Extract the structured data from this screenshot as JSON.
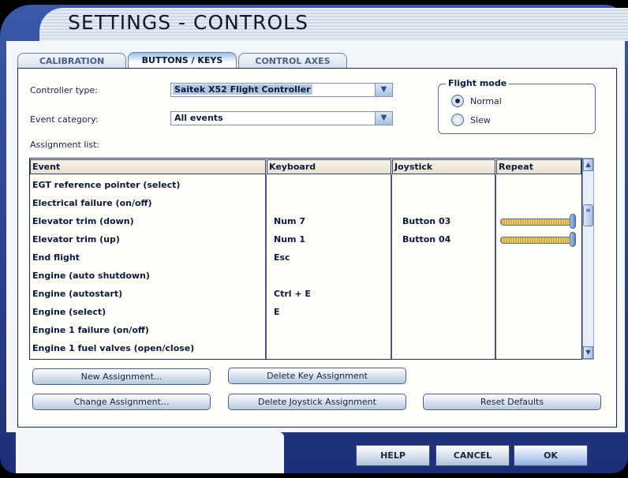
{
  "window": {
    "title": "SETTINGS - CONTROLS"
  },
  "tabs": [
    {
      "label": "CALIBRATION",
      "active": false
    },
    {
      "label": "BUTTONS / KEYS",
      "active": true
    },
    {
      "label": "CONTROL AXES",
      "active": false
    }
  ],
  "form": {
    "controller_type_label": "Controller type:",
    "controller_type_value": "Saitek X52 Flight Controller",
    "event_category_label": "Event category:",
    "event_category_value": "All events",
    "assignment_list_label": "Assignment list:"
  },
  "flight_mode": {
    "title": "Flight mode",
    "options": [
      {
        "label": "Normal",
        "selected": true
      },
      {
        "label": "Slew",
        "selected": false
      }
    ]
  },
  "table": {
    "headers": [
      "Event",
      "Keyboard",
      "Joystick",
      "Repeat"
    ],
    "rows": [
      {
        "event": "EGT reference pointer (select)",
        "keyboard": "",
        "joystick": "",
        "repeat": null
      },
      {
        "event": "Electrical failure (on/off)",
        "keyboard": "",
        "joystick": "",
        "repeat": null
      },
      {
        "event": "Elevator trim (down)",
        "keyboard": "Num 7",
        "joystick": "Button 03",
        "repeat": 1.0
      },
      {
        "event": "Elevator trim (up)",
        "keyboard": "Num 1",
        "joystick": "Button 04",
        "repeat": 1.0
      },
      {
        "event": "End flight",
        "keyboard": "Esc",
        "joystick": "",
        "repeat": null
      },
      {
        "event": "Engine (auto shutdown)",
        "keyboard": "",
        "joystick": "",
        "repeat": null
      },
      {
        "event": "Engine (autostart)",
        "keyboard": "Ctrl + E",
        "joystick": "",
        "repeat": null
      },
      {
        "event": "Engine (select)",
        "keyboard": "E",
        "joystick": "",
        "repeat": null
      },
      {
        "event": "Engine 1 failure (on/off)",
        "keyboard": "",
        "joystick": "",
        "repeat": null
      },
      {
        "event": "Engine 1 fuel valves (open/close)",
        "keyboard": "",
        "joystick": "",
        "repeat": null
      }
    ]
  },
  "buttons": {
    "new_assignment": "New Assignment...",
    "delete_key": "Delete Key Assignment",
    "change_assignment": "Change Assignment...",
    "delete_joystick": "Delete Joystick Assignment",
    "reset_defaults": "Reset Defaults"
  },
  "footer": {
    "help": "HELP",
    "cancel": "CANCEL",
    "ok": "OK"
  }
}
